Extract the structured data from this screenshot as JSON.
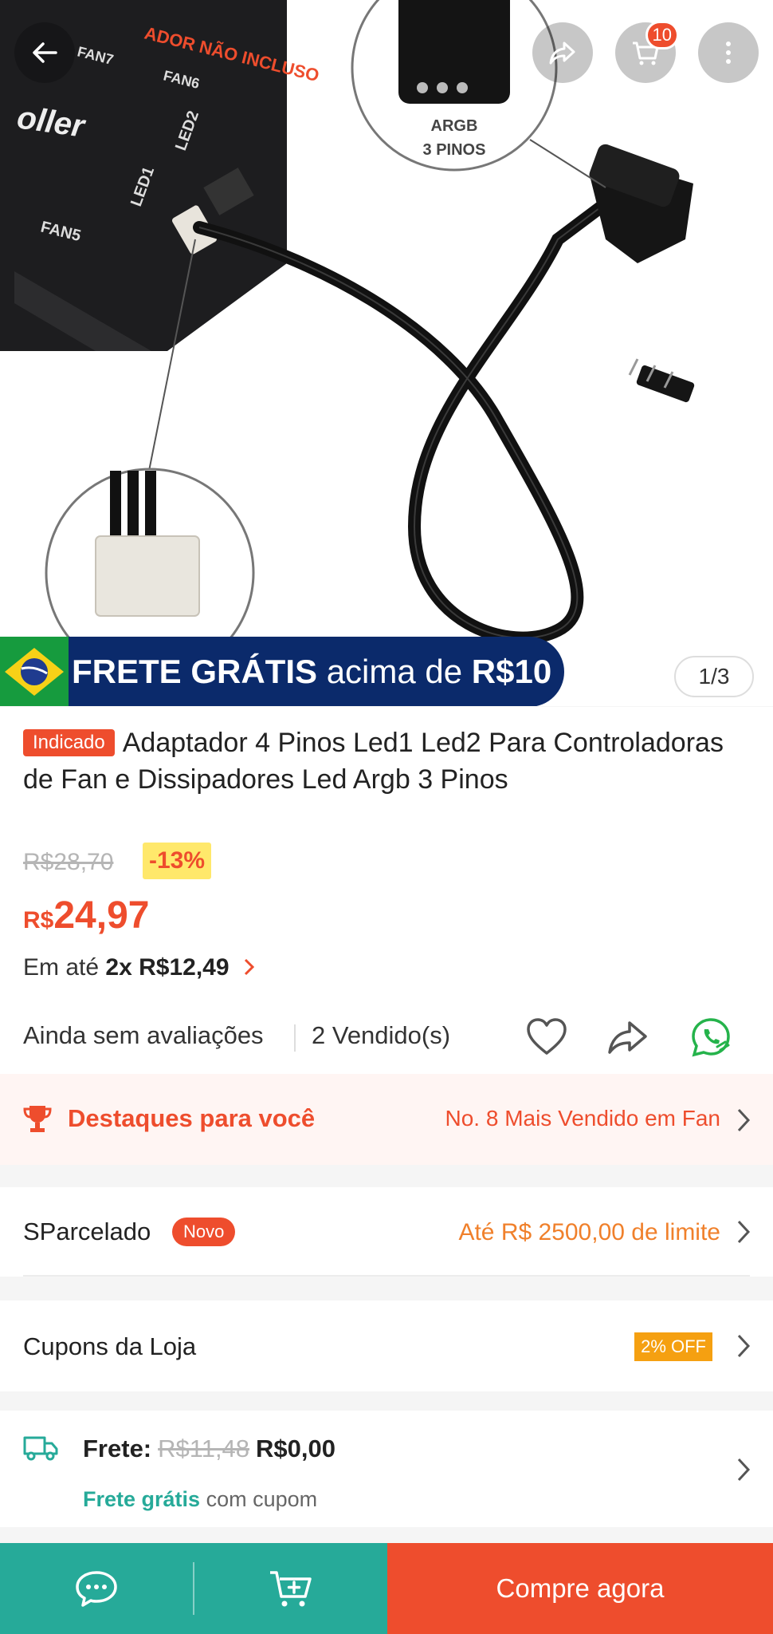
{
  "header": {
    "cart_count": "10",
    "icons": [
      "arrow-left-icon",
      "share-icon",
      "cart-icon",
      "more-icon"
    ]
  },
  "gallery": {
    "image_texts": {
      "top_label": "ADOR NÃO INCLUSO",
      "fan7": "FAN7",
      "fan6": "FAN6",
      "controller": "oller",
      "led2": "LED2",
      "led1": "LED1",
      "fan5": "FAN5",
      "argb_line1": "ARGB",
      "argb_line2": "3 PINOS"
    },
    "banner_bold": "FRETE GRÁTIS",
    "banner_regular": "acima de",
    "banner_amount": "R$10",
    "counter": "1/3"
  },
  "product": {
    "tag": "Indicado",
    "title": "Adaptador 4 Pinos Led1 Led2 Para Controladoras de Fan e Dissipadores Led Argb 3 Pinos",
    "old_price": "R$28,70",
    "discount": "-13%",
    "price_currency": "R$",
    "price_value": "24,97",
    "installments_prefix": "Em até",
    "installments_value": "2x R$12,49",
    "ratings_text": "Ainda sem avaliações",
    "sold_text": "2 Vendido(s)"
  },
  "highlights": {
    "label": "Destaques para você",
    "rank": "No. 8 Mais Vendido em Fan"
  },
  "sparcelado": {
    "label": "SParcelado",
    "badge": "Novo",
    "limit": "Até R$ 2500,00 de limite"
  },
  "coupons": {
    "label": "Cupons da Loja",
    "tag": "2% OFF"
  },
  "shipping": {
    "label": "Frete:",
    "old_price": "R$11,48",
    "price": "R$0,00",
    "free_label": "Frete grátis",
    "free_suffix": "com cupom"
  },
  "bottom_bar": {
    "buy_label": "Compre agora"
  },
  "colors": {
    "brand": "#ee4d2d",
    "teal": "#26aa99",
    "orange": "#f0802b",
    "banner_navy": "#0b2a6b"
  }
}
